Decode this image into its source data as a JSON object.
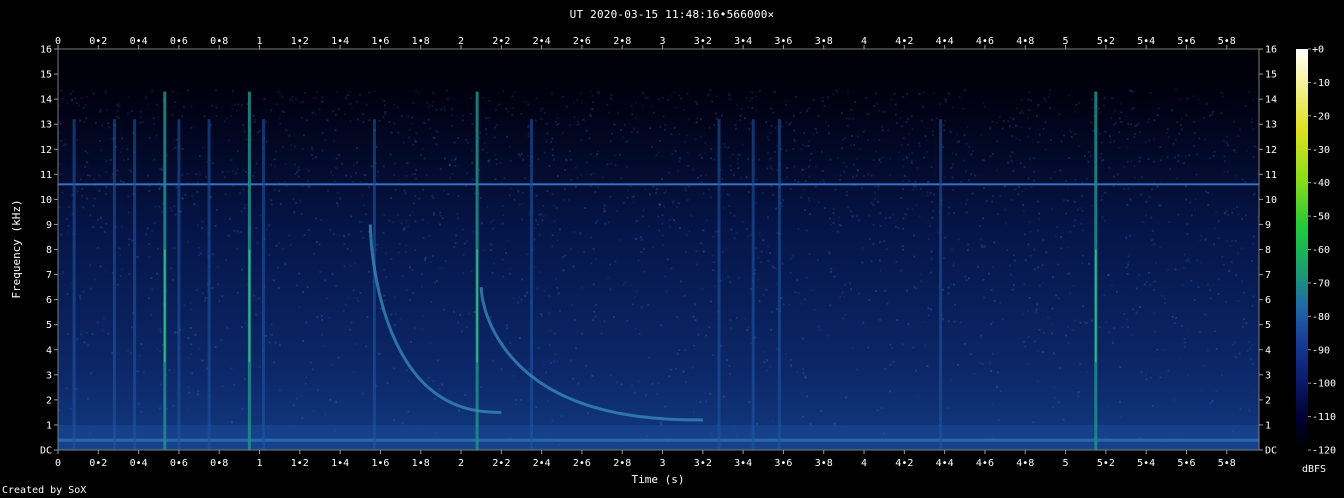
{
  "title": "UT 2020-03-15 11:48:16•566000×",
  "credit": "Created by SoX",
  "chart_data": {
    "type": "heatmap",
    "title": "UT 2020-03-15 11:48:16•566000×",
    "xlabel": "Time (s)",
    "ylabel": "Frequency (kHz)",
    "xlim": [
      0,
      5.96
    ],
    "ylim": [
      0,
      16
    ],
    "x_ticks": [
      "0",
      "0•2",
      "0•4",
      "0•6",
      "0•8",
      "1",
      "1•2",
      "1•4",
      "1•6",
      "1•8",
      "2",
      "2•2",
      "2•4",
      "2•6",
      "2•8",
      "3",
      "3•2",
      "3•4",
      "3•6",
      "3•8",
      "4",
      "4•2",
      "4•4",
      "4•6",
      "4•8",
      "5",
      "5•2",
      "5•4",
      "5•6",
      "5•8"
    ],
    "x_tick_values": [
      0,
      0.2,
      0.4,
      0.6,
      0.8,
      1,
      1.2,
      1.4,
      1.6,
      1.8,
      2,
      2.2,
      2.4,
      2.6,
      2.8,
      3,
      3.2,
      3.4,
      3.6,
      3.8,
      4,
      4.2,
      4.4,
      4.6,
      4.8,
      5,
      5.2,
      5.4,
      5.6,
      5.8
    ],
    "y_ticks": [
      "DC",
      "1",
      "2",
      "3",
      "4",
      "5",
      "6",
      "7",
      "8",
      "9",
      "10",
      "11",
      "12",
      "13",
      "14",
      "15",
      "16"
    ],
    "y_tick_values": [
      0,
      1,
      2,
      3,
      4,
      5,
      6,
      7,
      8,
      9,
      10,
      11,
      12,
      13,
      14,
      15,
      16
    ],
    "colorbar": {
      "label": "dBFS",
      "ticks": [
        "+0",
        "-10",
        "-20",
        "-30",
        "-40",
        "-50",
        "-60",
        "-70",
        "-80",
        "-90",
        "-100",
        "-110",
        "-120"
      ],
      "values": [
        0,
        -10,
        -20,
        -30,
        -40,
        -50,
        -60,
        -70,
        -80,
        -90,
        -100,
        -110,
        -120
      ],
      "range": [
        -120,
        0
      ]
    },
    "colors": {
      "low": "#000020",
      "mid": "#1a4fa0",
      "high": "#2ecc71",
      "top": "#ffffee"
    },
    "features": {
      "horizontal_line_khz": 10.6,
      "impulses_s": [
        0.08,
        0.28,
        0.38,
        0.53,
        0.6,
        0.75,
        0.95,
        1.02,
        1.57,
        2.08,
        2.35,
        3.28,
        3.45,
        3.58,
        4.38,
        5.15
      ],
      "whistler_1": {
        "start_s": 1.55,
        "start_khz": 9.0,
        "end_s": 2.2,
        "end_khz": 1.5
      },
      "whistler_2": {
        "start_s": 2.1,
        "start_khz": 6.5,
        "end_s": 3.2,
        "end_khz": 1.2
      }
    }
  }
}
